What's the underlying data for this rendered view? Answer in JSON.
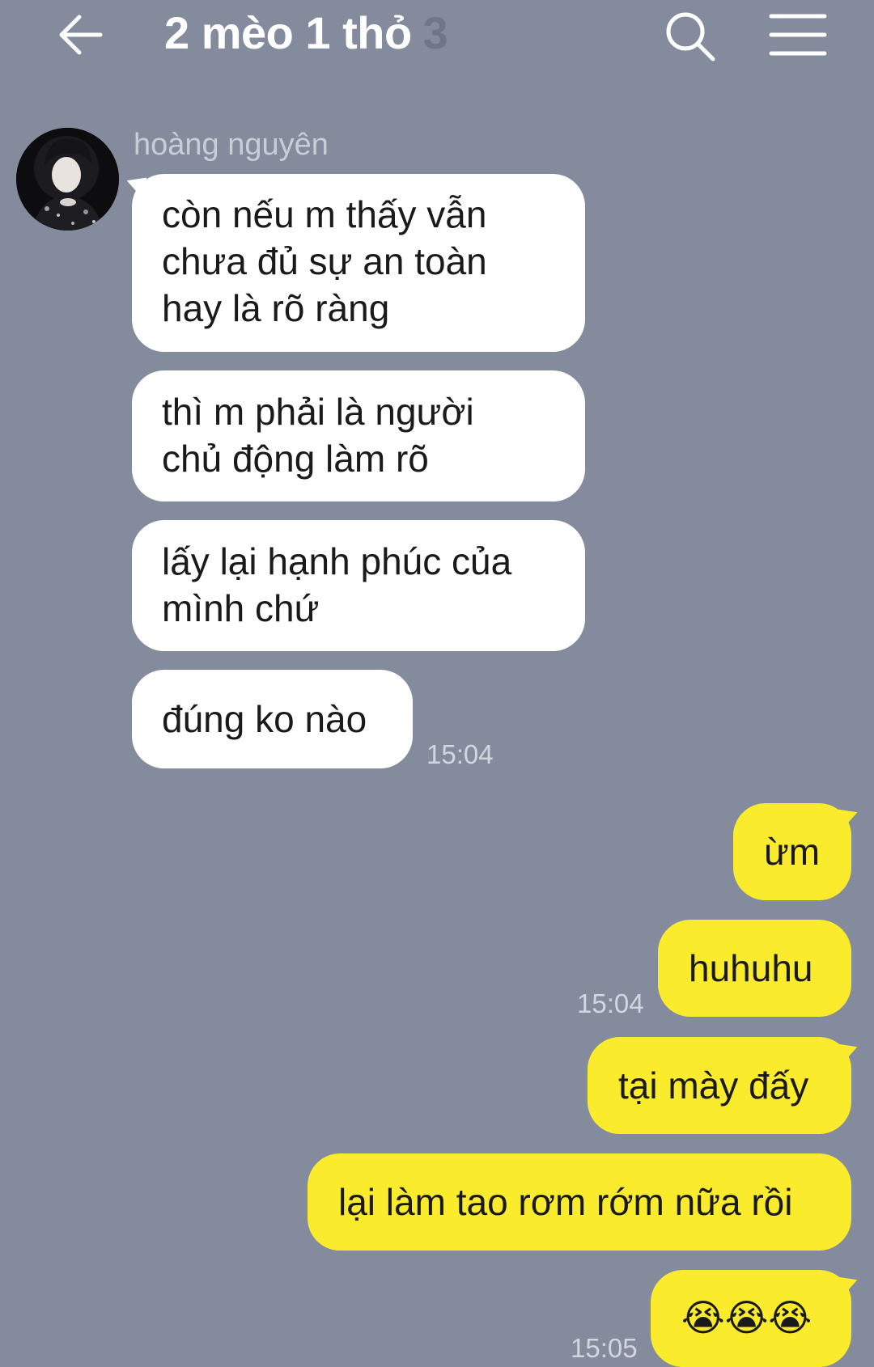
{
  "header": {
    "back_icon": "arrow-left-icon",
    "title": "2 mèo 1 thỏ",
    "member_count": "3",
    "search_icon": "search-icon",
    "menu_icon": "menu-icon"
  },
  "colors": {
    "background": "#838b9c",
    "incoming_bubble": "#ffffff",
    "outgoing_bubble": "#fbeb2d",
    "text": "#1a1a1a",
    "timestamp": "#d3d6de"
  },
  "incoming": {
    "sender_name": "hoàng nguyên",
    "messages": [
      {
        "lines": [
          "còn nếu m thấy vẫn",
          "chưa đủ sự an toàn",
          "hay là rõ ràng"
        ]
      },
      {
        "lines": [
          "thì m phải là người",
          "chủ động làm rõ"
        ]
      },
      {
        "lines": [
          "lấy lại hạnh phúc của",
          "mình chứ"
        ]
      },
      {
        "lines": [
          "đúng ko nào"
        ]
      }
    ],
    "time": "15:04"
  },
  "outgoing": {
    "messages": [
      {
        "text": "ừm"
      },
      {
        "text": "huhuhu"
      },
      {
        "text": "tại mày đấy"
      },
      {
        "text": "lại làm tao rơm rớm nữa rồi"
      },
      {
        "text": "😭😭😭"
      }
    ],
    "time_1": "15:04",
    "time_2": "15:05"
  }
}
